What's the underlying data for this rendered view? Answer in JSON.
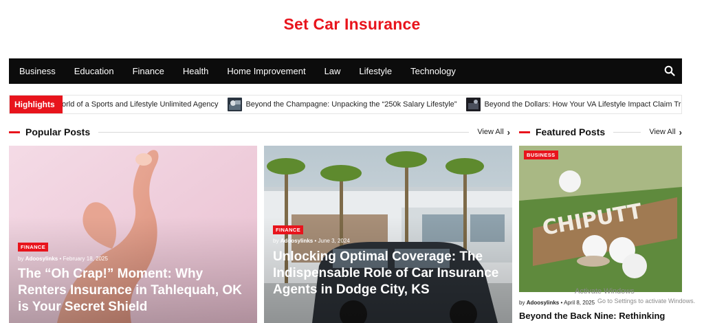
{
  "site": {
    "title": "Set Car Insurance"
  },
  "nav": {
    "items": [
      "Business",
      "Education",
      "Finance",
      "Health",
      "Home Improvement",
      "Law",
      "Lifestyle",
      "Technology"
    ],
    "search_icon": "search-icon"
  },
  "ticker": {
    "label": "Highlights",
    "items": [
      "orld of a Sports and Lifestyle Unlimited Agency",
      "Beyond the Champagne: Unpacking the “250k Salary Lifestyle”",
      "Beyond the Dollars: How Your VA Lifestyle Impact Claim Truly Shapes You"
    ]
  },
  "popular": {
    "title": "Popular Posts",
    "view_all": "View All",
    "posts": [
      {
        "category": "FINANCE",
        "by": "by",
        "author": "Adoosylinks",
        "date": "February 18, 2025",
        "title": "The “Oh Crap!” Moment: Why Renters Insurance in Tahlequah, OK is Your Secret Shield"
      },
      {
        "category": "FINANCE",
        "by": "by",
        "author": "Adoosylinks",
        "date": "June 3, 2024",
        "title": "Unlocking Optimal Coverage: The Indispensable Role of Car Insurance Agents in Dodge City, KS"
      }
    ]
  },
  "featured": {
    "title": "Featured Posts",
    "view_all": "View All",
    "post": {
      "category": "BUSINESS",
      "by": "by",
      "author": "Adoosylinks",
      "date": "April 8, 2025",
      "title": "Beyond the Back Nine: Rethinking",
      "image_text": "CHIPUTT"
    }
  },
  "watermark": {
    "line1": "Activate Windows",
    "line2": "Go to Settings to activate Windows."
  },
  "colors": {
    "accent": "#e8141c",
    "nav_bg": "#0c0c0c"
  }
}
